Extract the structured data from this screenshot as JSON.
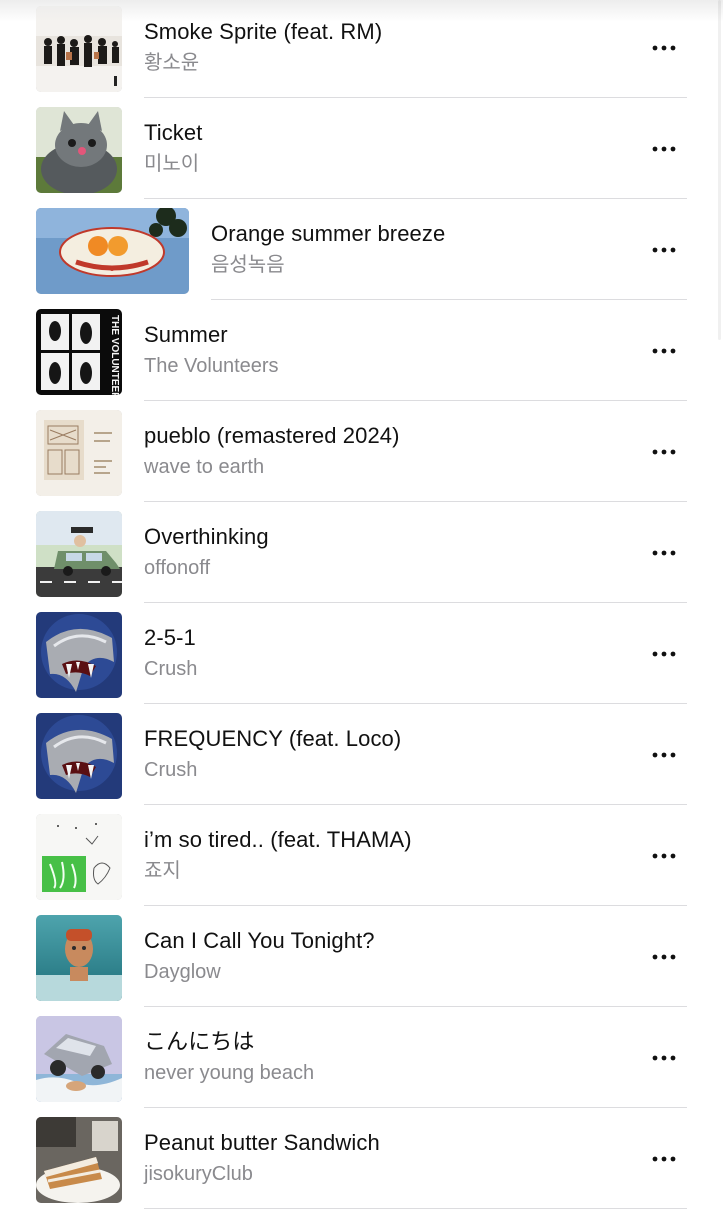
{
  "songs": [
    {
      "title": "Smoke Sprite (feat. RM)",
      "artist": "황소윤",
      "art": "band-group-art"
    },
    {
      "title": "Ticket",
      "artist": "미노이",
      "art": "gray-cat-art"
    },
    {
      "title": "Orange summer breeze",
      "artist": "음성녹음",
      "art": "orange-logo-art",
      "wide": true
    },
    {
      "title": "Summer",
      "artist": "The Volunteers",
      "art": "volunteers-poster-art",
      "art_text": "THE VOLUNTEERS"
    },
    {
      "title": "pueblo (remastered 2024)",
      "artist": "wave to earth",
      "art": "sepia-sketch-art"
    },
    {
      "title": "Overthinking",
      "artist": "offonoff",
      "art": "car-illustration-art"
    },
    {
      "title": "2-5-1",
      "artist": "Crush",
      "art": "wolf-fang-art"
    },
    {
      "title": "FREQUENCY (feat. Loco)",
      "artist": "Crush",
      "art": "wolf-fang-art"
    },
    {
      "title": "i’m so tired.. (feat. THAMA)",
      "artist": "죠지",
      "art": "doodle-art"
    },
    {
      "title": "Can I Call You Tonight?",
      "artist": "Dayglow",
      "art": "underwater-face-art"
    },
    {
      "title": "こんにちは",
      "artist": "never young beach",
      "art": "flying-car-art"
    },
    {
      "title": "Peanut butter Sandwich",
      "artist": "jisokuryClub",
      "art": "cake-photo-art"
    }
  ],
  "colors": {
    "title": "#111111",
    "subtitle": "#8a8a8e",
    "separator": "#dcdcdf",
    "background": "#ffffff"
  },
  "icons": {
    "more": "more-horizontal-icon"
  }
}
